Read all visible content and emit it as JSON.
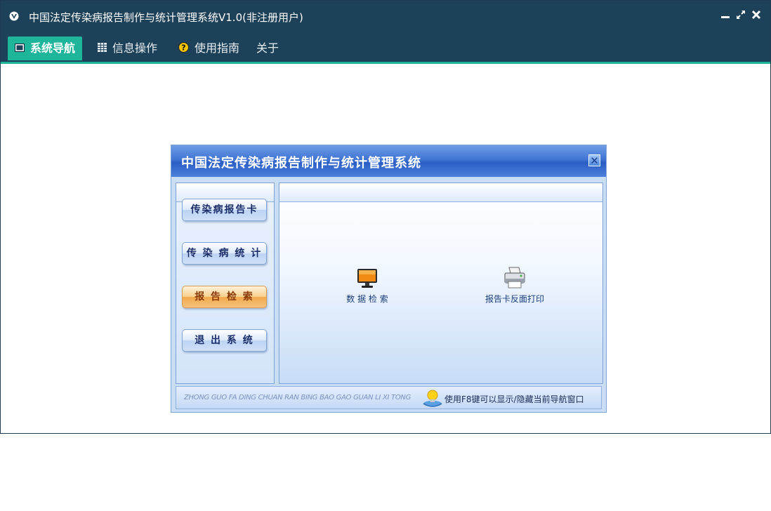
{
  "window": {
    "title": "中国法定传染病报告制作与统计管理系统V1.0(非注册用户)",
    "controls": {
      "minimize": "▁",
      "restore": "↗",
      "close": "✖"
    }
  },
  "menubar": {
    "items": [
      {
        "label": "系统导航",
        "icon": "monitor-icon",
        "active": true
      },
      {
        "label": "信息操作",
        "icon": "grid-icon",
        "active": false
      },
      {
        "label": "使用指南",
        "icon": "help-icon",
        "active": false
      },
      {
        "label": "关于",
        "icon": "",
        "active": false
      }
    ]
  },
  "dialog": {
    "title": "中国法定传染病报告制作与统计管理系统",
    "close_glyph": "✕",
    "left_buttons": [
      {
        "label": "传染病报告卡",
        "selected": false
      },
      {
        "label": "传 染 病 统 计",
        "selected": false
      },
      {
        "label": "报 告 检 索",
        "selected": true
      },
      {
        "label": "退 出 系 统",
        "selected": false
      }
    ],
    "functions": [
      {
        "label": "数  据  检  索",
        "icon": "monitor-icon"
      },
      {
        "label": "报告卡反面打印",
        "icon": "printer-icon"
      }
    ],
    "footer": {
      "pinyin": "ZHONG GUO FA DING CHUAN RAN BING BAO GAO GUAN LI XI TONG",
      "tip": "使用F8键可以显示/隐藏当前导航窗口"
    }
  },
  "colors": {
    "titlebar": "#1d4158",
    "accent": "#1fb59a",
    "dialog_title": "#3f74d3",
    "selected_button": "#f2a94b"
  }
}
